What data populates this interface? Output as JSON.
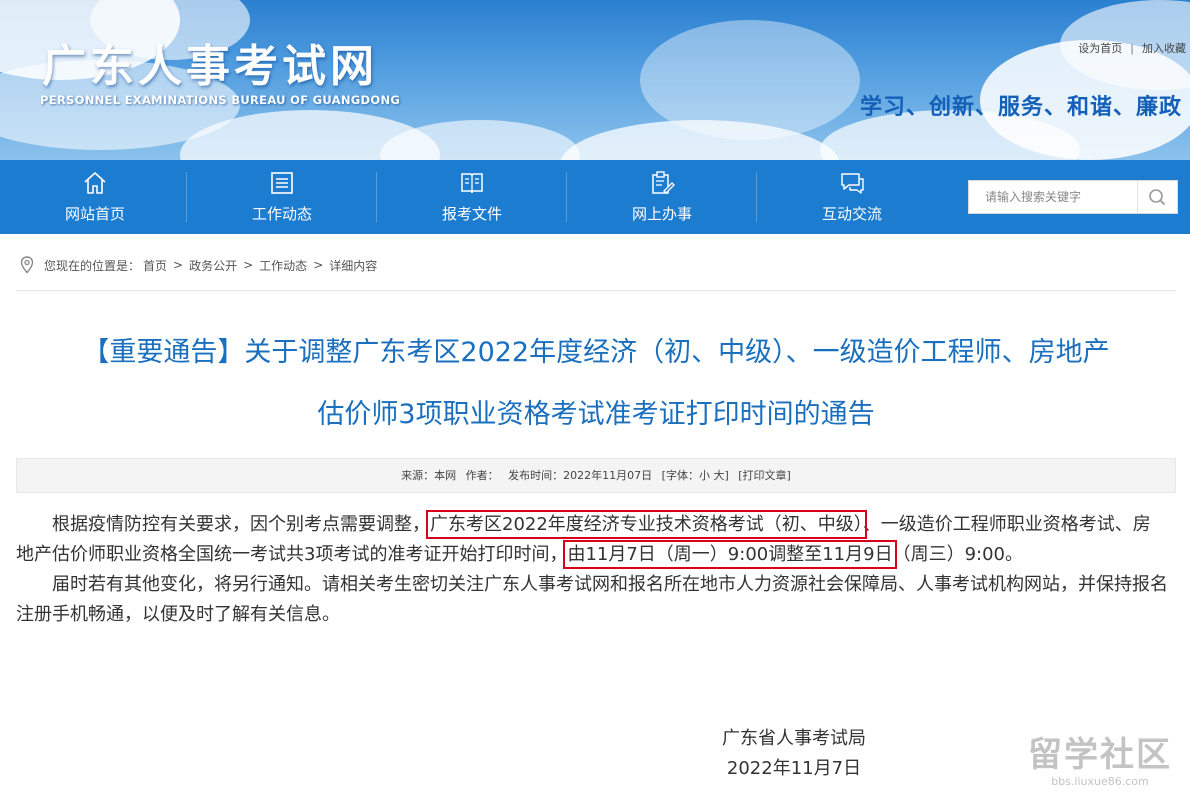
{
  "header": {
    "site_title": "广东人事考试网",
    "site_subtitle": "PERSONNEL EXAMINATIONS BUREAU OF GUANGDONG",
    "top_links": [
      "设为首页",
      "加入收藏"
    ],
    "slogan": "学习、创新、服务、和谐、廉政"
  },
  "nav": {
    "items": [
      {
        "label": "网站首页",
        "icon": "home-icon"
      },
      {
        "label": "工作动态",
        "icon": "news-list-icon"
      },
      {
        "label": "报考文件",
        "icon": "document-icon"
      },
      {
        "label": "网上办事",
        "icon": "clipboard-edit-icon"
      },
      {
        "label": "互动交流",
        "icon": "chat-bubbles-icon"
      }
    ],
    "search_placeholder": "请输入搜索关键字"
  },
  "breadcrumb": {
    "prefix": "您现在的位置是：",
    "items": [
      "首页",
      "政务公开",
      "工作动态",
      "详细内容"
    ]
  },
  "article": {
    "title_line1": "【重要通告】关于调整广东考区2022年度经济（初、中级）、一级造价工程师、房地产",
    "title_line2": "估价师3项职业资格考试准考证打印时间的通告",
    "meta": {
      "source": "来源：本网",
      "author": "作者：",
      "date": "发布时间：2022年11月07日",
      "font": "[字体：小 大]",
      "print": "[打印文章]"
    },
    "para1_a": "根据疫情防控有关要求，因个别考点需要调整，",
    "para1_hl1": "广东考区2022年度经济专业技术资格考试（初、中级）",
    "para1_b": "、一级造价工程师职业资格考试、房地产估价师职业资格全国统一考试共3项考试的准考证开始打印时间，",
    "para1_hl2": "由11月7日（周一）9:00调整至11月9日",
    "para1_c": "（周三）9:00。",
    "para2": "届时若有其他变化，将另行通知。请相关考生密切关注广东人事考试网和报名所在地市人力资源社会保障局、人事考试机构网站，并保持报名注册手机畅通，以便及时了解有关信息。",
    "sign_org": "广东省人事考试局",
    "sign_date": "2022年11月7日"
  },
  "watermark": {
    "text": "留学社区",
    "url": "bbs.liuxue86.com"
  },
  "colors": {
    "nav_bg": "#1c7cd0",
    "title": "#1a6fbe",
    "highlight_border": "#d9001b"
  }
}
